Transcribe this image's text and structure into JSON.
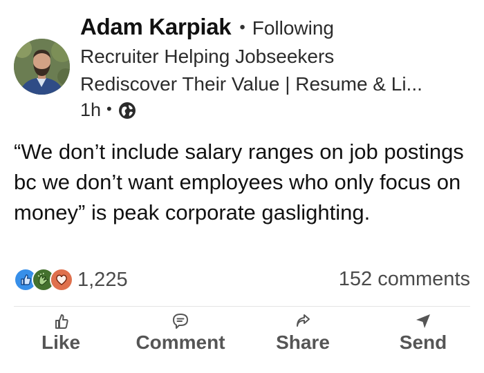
{
  "post": {
    "author": {
      "name": "Adam Karpiak",
      "separator": "•",
      "follow_status": "Following",
      "headline_line1": "Recruiter Helping Jobseekers",
      "headline_line2": "Rediscover Their Value | Resume & Li...",
      "time": "1h",
      "visibility_icon": "globe-icon"
    },
    "text": "“We don’t include salary ranges on job postings bc we don’t want employees who only focus on money” is peak corporate gaslighting.",
    "reactions": {
      "icons": [
        "like-reaction-icon",
        "celebrate-reaction-icon",
        "love-reaction-icon"
      ],
      "count": "1,225"
    },
    "comments": "152 comments"
  },
  "actions": {
    "like": "Like",
    "comment": "Comment",
    "share": "Share",
    "send": "Send"
  },
  "colors": {
    "like": "#378fe9",
    "celebrate": "#44712e",
    "love": "#df704d"
  }
}
